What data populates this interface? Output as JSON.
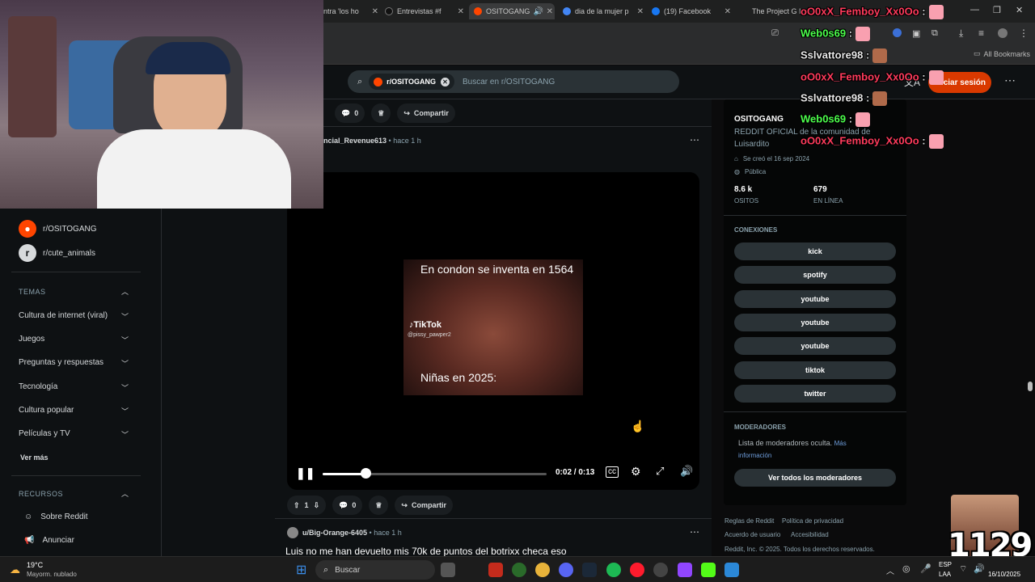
{
  "browser": {
    "tabs": [
      {
        "label": "ntra 'los ho",
        "icon_color": "#999"
      },
      {
        "label": "Entrevistas #f",
        "icon_color": "#111"
      },
      {
        "label": "OSITOGANG",
        "icon_color": "#ff4500"
      },
      {
        "label": "dia de la mujer p",
        "icon_color": "#4285f4"
      },
      {
        "label": "(19) Facebook",
        "icon_color": "#1877f2"
      },
      {
        "label": "The Project G I",
        "icon_color": "#888"
      }
    ],
    "bookmarks_label": "All Bookmarks"
  },
  "header": {
    "search_chip": "r/OSITOGANG",
    "search_placeholder": "Buscar en r/OSITOGANG",
    "login_label": "Iniciar sesión"
  },
  "sidebar": {
    "communities": [
      {
        "label": "r/OSITOGANG",
        "color": "#ff4500"
      },
      {
        "label": "r/cute_animals",
        "color": "#d7dadc"
      }
    ],
    "topics_title": "TEMAS",
    "topics": [
      "Cultura de internet (viral)",
      "Juegos",
      "Preguntas y respuestas",
      "Tecnología",
      "Cultura popular",
      "Películas y TV"
    ],
    "see_more": "Ver más",
    "resources_title": "RECURSOS",
    "resources": [
      "Sobre Reddit",
      "Anunciar"
    ]
  },
  "feed": {
    "top_actions": {
      "comments": "0",
      "share": "Compartir"
    },
    "post1": {
      "author": "ncial_Revenue613",
      "time": "hace 1 h",
      "video": {
        "caption_top": "En condon se inventa en 1564",
        "caption_bottom": "Niñas en 2025:",
        "tiktok": "TikTok",
        "tiktok_user": "@pissy_pawper2",
        "time": "0:02 / 0:13",
        "progress": 0.19
      },
      "votes": "1",
      "comments": "0",
      "share": "Compartir"
    },
    "post2": {
      "author": "u/Big-Orange-6405",
      "time": "hace 1 h",
      "title": "Luis no me han devuelto mis 70k de puntos del botrixx checa eso"
    }
  },
  "community": {
    "name": "OSITOGANG",
    "description": "REDDIT OFICIAL de la comunidad de Luisardito",
    "created": "Se creó el 16 sep 2024",
    "visibility": "Pública",
    "members": "8.6 k",
    "members_label": "OSITOS",
    "online": "679",
    "online_label": "EN LÍNEA",
    "connections_title": "CONEXIONES",
    "connections": [
      "kick",
      "spotify",
      "youtube",
      "youtube",
      "youtube",
      "tiktok",
      "twitter"
    ],
    "mods_title": "MODERADORES",
    "mods_hidden": "Lista de moderadores oculta.",
    "mods_more": "Más información",
    "mods_button": "Ver todos los moderadores"
  },
  "footer": {
    "links": [
      "Reglas de Reddit",
      "Política de privacidad",
      "Acuerdo de usuario",
      "Accesibilidad"
    ],
    "copyright": "Reddit, Inc. © 2025. Todos los derechos reservados."
  },
  "chat": [
    {
      "user": "oO0xX_Femboy_Xx0Oo",
      "color": "#ff3b5c"
    },
    {
      "user": "Web0s69",
      "color": "#4cff4c"
    },
    {
      "user": "Sslvattore98",
      "color": "#e8e8e8"
    },
    {
      "user": "oO0xX_Femboy_Xx0Oo",
      "color": "#ff3b5c"
    },
    {
      "user": "Sslvattore98",
      "color": "#e8e8e8"
    },
    {
      "user": "Web0s69",
      "color": "#4cff4c"
    },
    {
      "user": "oO0xX_Femboy_Xx0Oo",
      "color": "#ff3b5c"
    }
  ],
  "overlay": {
    "counter": "1129"
  },
  "taskbar": {
    "weather_temp": "19°C",
    "weather_desc": "Mayorm. nublado",
    "search": "Buscar",
    "lang1": "ESP",
    "lang2": "LAA",
    "clock_time": "",
    "clock_date": "16/10/2025"
  }
}
